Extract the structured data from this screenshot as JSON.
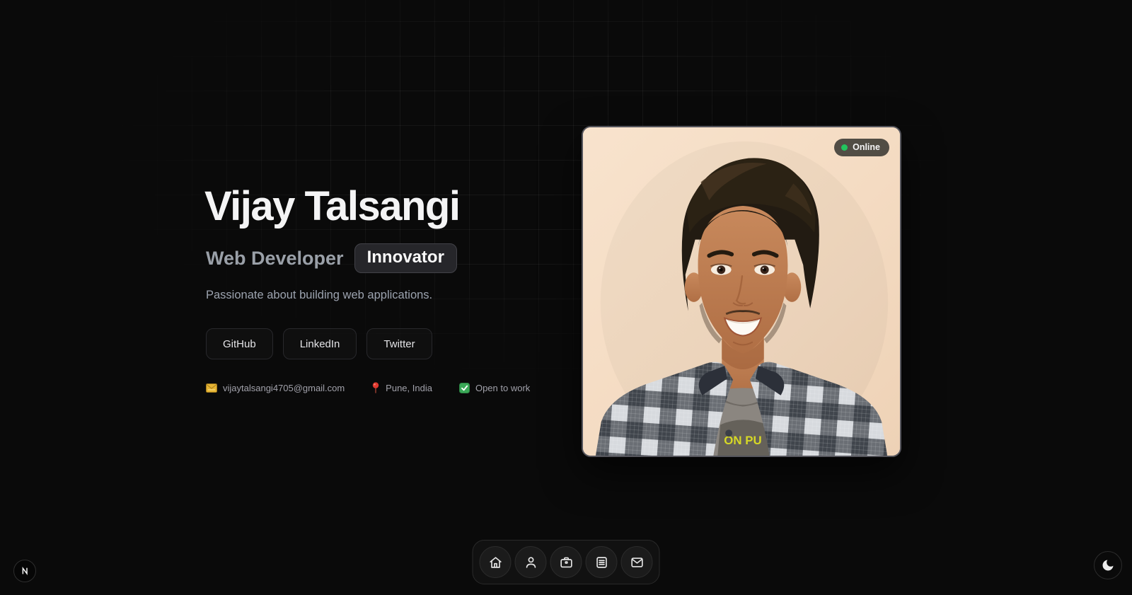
{
  "hero": {
    "name": "Vijay Talsangi",
    "role": "Web Developer",
    "badge": "Innovator",
    "tagline": "Passionate about building web applications.",
    "social_buttons": [
      {
        "label": "GitHub"
      },
      {
        "label": "LinkedIn"
      },
      {
        "label": "Twitter"
      }
    ],
    "contacts": [
      {
        "icon": "envelope-icon",
        "text": "vijaytalsangi4705@gmail.com"
      },
      {
        "icon": "pin-icon",
        "text": "Pune, India"
      },
      {
        "icon": "check-icon",
        "text": "Open to work"
      }
    ]
  },
  "photo_card": {
    "status_label": "Online",
    "tshirt_text": "ON PU"
  },
  "dock": {
    "items": [
      {
        "icon": "home-icon"
      },
      {
        "icon": "user-icon"
      },
      {
        "icon": "briefcase-icon"
      },
      {
        "icon": "resume-icon"
      },
      {
        "icon": "mail-icon"
      }
    ]
  },
  "brand": {
    "logo_letter": "N"
  },
  "theme_toggle": {
    "icon": "moon-icon"
  },
  "colors": {
    "background": "#0a0a0a",
    "status_online": "#22c55e",
    "photo_backdrop": "#f4dcc4",
    "badge_border": "#424248"
  }
}
